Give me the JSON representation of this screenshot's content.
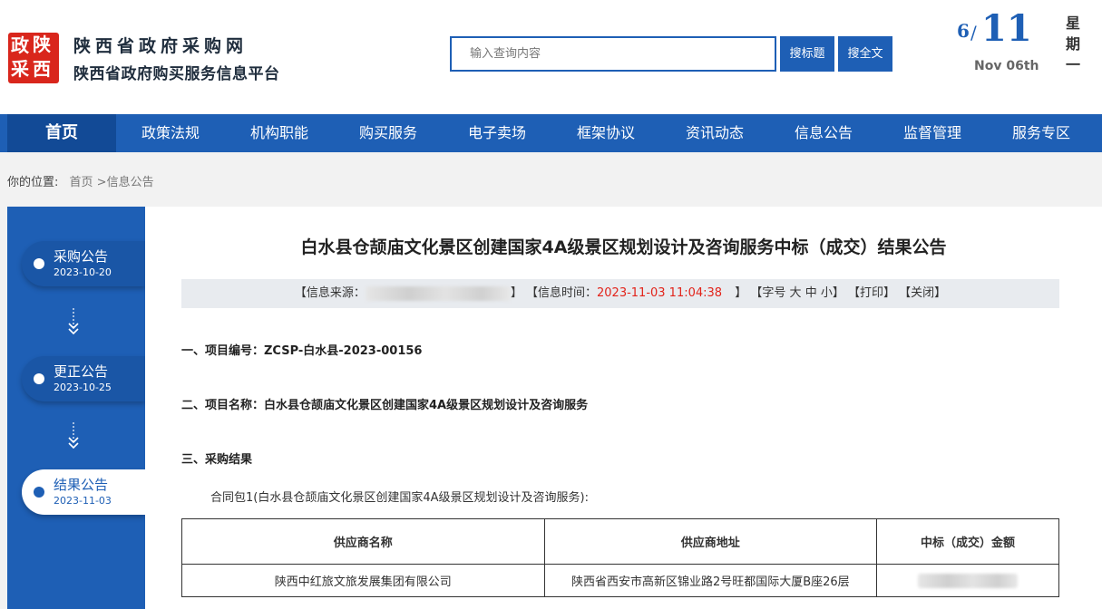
{
  "header": {
    "logo_chars": [
      "政",
      "陕",
      "采",
      "西"
    ],
    "site_title": "陕西省政府采购网",
    "site_subtitle": "陕西省政府购买服务信息平台",
    "search": {
      "placeholder": "输入查询内容",
      "btn_title": "搜标题",
      "btn_full": "搜全文"
    },
    "date": {
      "month": "6",
      "slash": "/",
      "day": "11",
      "english": "Nov 06th",
      "weekday": [
        "星",
        "期",
        "一"
      ]
    }
  },
  "nav": {
    "items": [
      "首页",
      "政策法规",
      "机构职能",
      "购买服务",
      "电子卖场",
      "框架协议",
      "资讯动态",
      "信息公告",
      "监督管理",
      "服务专区"
    ],
    "active_index": 0
  },
  "breadcrumb": {
    "prefix": "你的位置:",
    "home": "首页",
    "sep": " >",
    "current": "信息公告"
  },
  "sidebar": {
    "stages": [
      {
        "label": "采购公告",
        "date": "2023-10-20",
        "current": false
      },
      {
        "label": "更正公告",
        "date": "2023-10-25",
        "current": false
      },
      {
        "label": "结果公告",
        "date": "2023-11-03",
        "current": true
      }
    ]
  },
  "article": {
    "title": "白水县仓颉庙文化景区创建国家4A级景区规划设计及咨询服务中标（成交）结果公告",
    "meta": {
      "source_label": "【信息来源：",
      "source_close": "】",
      "time_label": "【信息时间：",
      "time_value": "2023-11-03 11:04:38",
      "time_close": "】",
      "font_label": "【字号",
      "font_sizes": [
        "大",
        "中",
        "小"
      ],
      "font_close": "】",
      "print": "【打印】",
      "close": "【关闭】"
    },
    "sections": {
      "project_no": "一、项目编号：ZCSP-白水县-2023-00156",
      "project_name": "二、项目名称：白水县仓颉庙文化景区创建国家4A级景区规划设计及咨询服务",
      "result": "三、采购结果"
    },
    "package": "合同包1(白水县仓颉庙文化景区创建国家4A级景区规划设计及咨询服务):",
    "table": {
      "headers": [
        "供应商名称",
        "供应商地址",
        "中标（成交）金额"
      ],
      "rows": [
        [
          "陕西中红旅文旅发展集团有限公司",
          "陕西省西安市高新区锦业路2号旺都国际大厦B座26层",
          ""
        ]
      ]
    }
  },
  "colors": {
    "brand_blue": "#1e5fb5",
    "nav_active": "#124a96",
    "logo_red": "#d9261c",
    "highlight_red": "#e2231a"
  }
}
